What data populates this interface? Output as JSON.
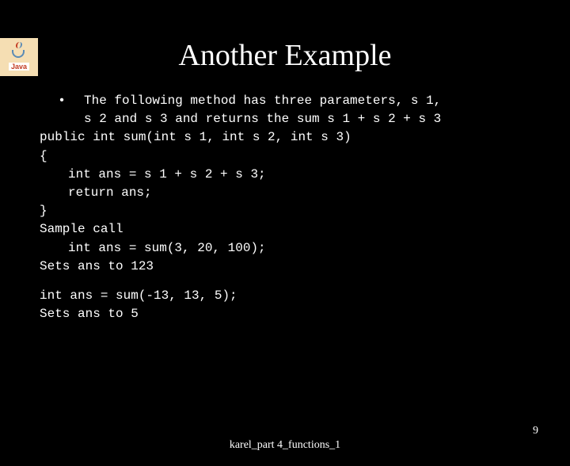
{
  "logo": {
    "text": "Java"
  },
  "title": "Another Example",
  "bullet": "•",
  "desc_line1": "The following method has three parameters, s 1,",
  "desc_line2": "s 2 and s 3 and returns the sum s 1 + s 2 + s 3",
  "code_sig": "public int sum(int s 1, int s 2, int s 3)",
  "code_open": "{",
  "code_body1": "int ans = s 1 + s 2 + s 3;",
  "code_body2": "return ans;",
  "code_close": "}",
  "sample_label": "Sample call",
  "sample_call": "int ans = sum(3, 20, 100);",
  "sample_result": "Sets ans to 123",
  "second_call": " int ans = sum(-13, 13, 5);",
  "second_result": "Sets ans to 5",
  "footer": "karel_part 4_functions_1",
  "page_number": "9"
}
